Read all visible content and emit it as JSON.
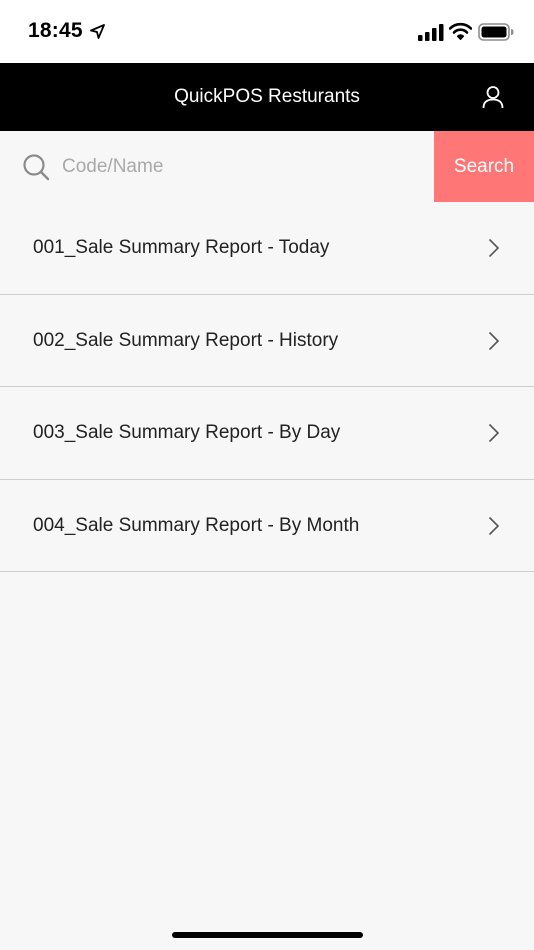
{
  "status_bar": {
    "time": "18:45",
    "icons": [
      "location-arrow-icon",
      "cellular-signal-icon",
      "wifi-icon",
      "battery-icon"
    ]
  },
  "header": {
    "title": "QuickPOS Resturants",
    "profile_icon": "user-icon"
  },
  "search": {
    "placeholder": "Code/Name",
    "value": "",
    "button_label": "Search",
    "button_color": "#ff7676"
  },
  "reports": [
    {
      "label": "001_Sale Summary Report - Today"
    },
    {
      "label": "002_Sale Summary Report - History"
    },
    {
      "label": "003_Sale Summary Report - By Day"
    },
    {
      "label": "004_Sale Summary Report - By Month"
    }
  ],
  "colors": {
    "header_bg": "#000000",
    "page_bg": "#f7f7f7",
    "accent": "#ff7676",
    "divider": "#cfcfcf"
  }
}
